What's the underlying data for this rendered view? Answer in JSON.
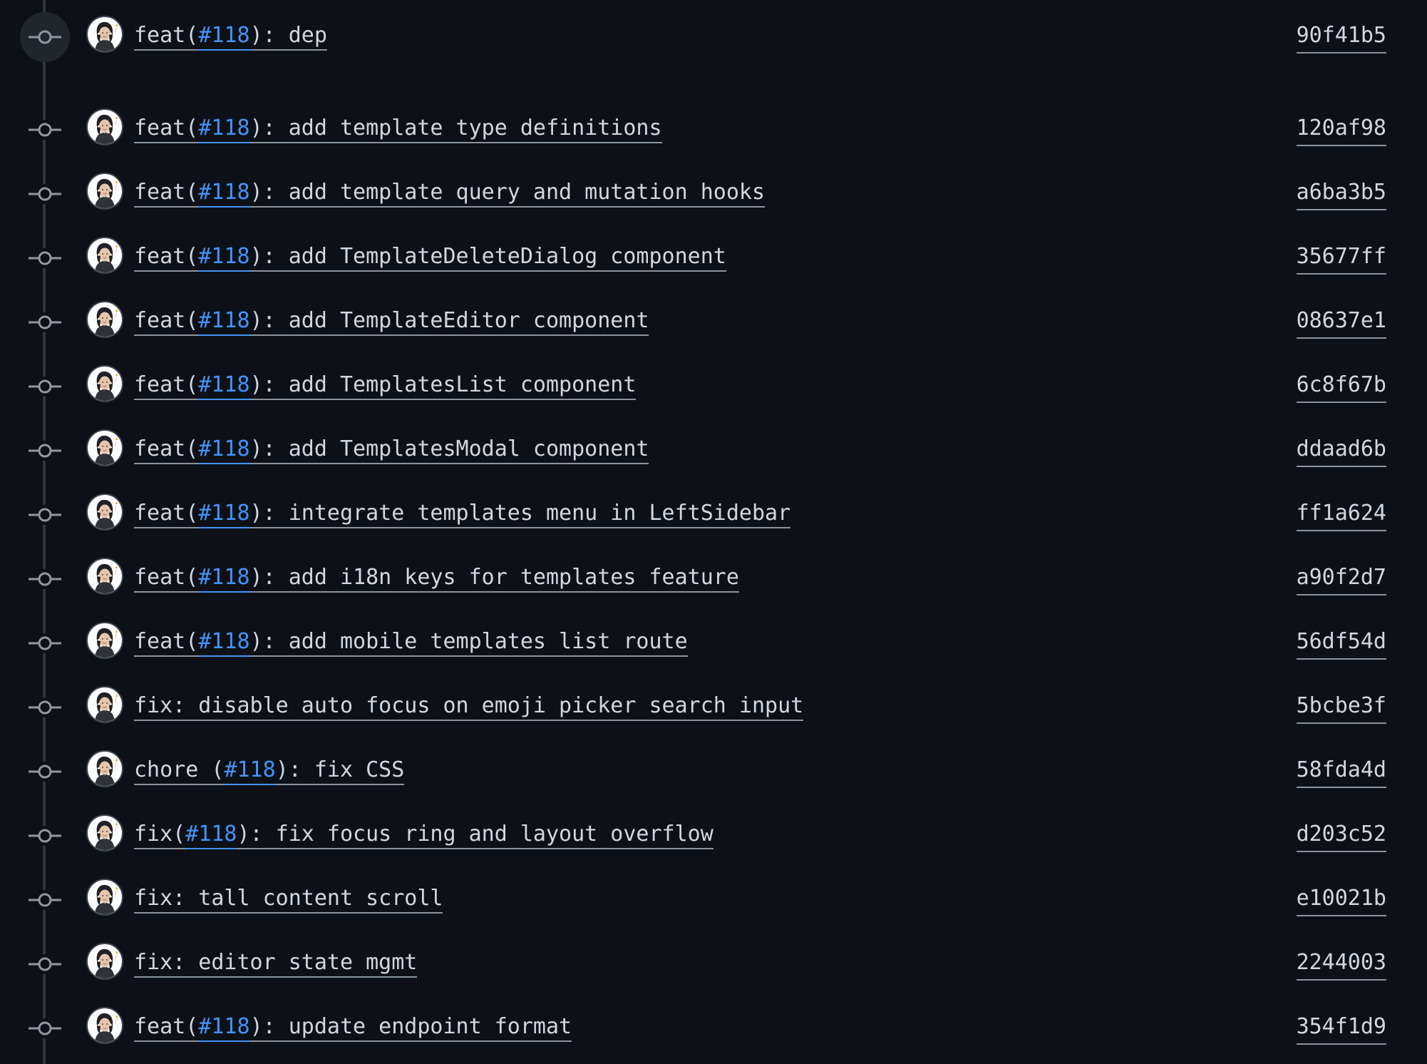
{
  "theme": {
    "background": "#0d1117",
    "text": "#d1d7e0",
    "link_issue": "#4493f8",
    "timeline": "#30363d",
    "hover_bg": "#21262d"
  },
  "icons": {
    "commit_node": "git-commit-icon",
    "author_avatar": "user-avatar"
  },
  "commits": [
    {
      "parts": [
        {
          "text": "feat("
        },
        {
          "text": "#118",
          "issue": true
        },
        {
          "text": "): dep"
        }
      ],
      "sha": "90f41b5",
      "hovered": true
    },
    {
      "parts": [
        {
          "text": "feat("
        },
        {
          "text": "#118",
          "issue": true
        },
        {
          "text": "): add template type definitions"
        }
      ],
      "sha": "120af98"
    },
    {
      "parts": [
        {
          "text": "feat("
        },
        {
          "text": "#118",
          "issue": true
        },
        {
          "text": "): add template query and mutation hooks"
        }
      ],
      "sha": "a6ba3b5"
    },
    {
      "parts": [
        {
          "text": "feat("
        },
        {
          "text": "#118",
          "issue": true
        },
        {
          "text": "): add TemplateDeleteDialog component"
        }
      ],
      "sha": "35677ff"
    },
    {
      "parts": [
        {
          "text": "feat("
        },
        {
          "text": "#118",
          "issue": true
        },
        {
          "text": "): add TemplateEditor component"
        }
      ],
      "sha": "08637e1"
    },
    {
      "parts": [
        {
          "text": "feat("
        },
        {
          "text": "#118",
          "issue": true
        },
        {
          "text": "): add TemplatesList component"
        }
      ],
      "sha": "6c8f67b"
    },
    {
      "parts": [
        {
          "text": "feat("
        },
        {
          "text": "#118",
          "issue": true
        },
        {
          "text": "): add TemplatesModal component"
        }
      ],
      "sha": "ddaad6b"
    },
    {
      "parts": [
        {
          "text": "feat("
        },
        {
          "text": "#118",
          "issue": true
        },
        {
          "text": "): integrate templates menu in LeftSidebar"
        }
      ],
      "sha": "ff1a624"
    },
    {
      "parts": [
        {
          "text": "feat("
        },
        {
          "text": "#118",
          "issue": true
        },
        {
          "text": "): add i18n keys for templates feature"
        }
      ],
      "sha": "a90f2d7"
    },
    {
      "parts": [
        {
          "text": "feat("
        },
        {
          "text": "#118",
          "issue": true
        },
        {
          "text": "): add mobile templates list route"
        }
      ],
      "sha": "56df54d"
    },
    {
      "parts": [
        {
          "text": "fix: disable auto focus on emoji picker search input"
        }
      ],
      "sha": "5bcbe3f"
    },
    {
      "parts": [
        {
          "text": "chore ("
        },
        {
          "text": "#118",
          "issue": true
        },
        {
          "text": "): fix CSS"
        }
      ],
      "sha": "58fda4d"
    },
    {
      "parts": [
        {
          "text": "fix("
        },
        {
          "text": "#118",
          "issue": true
        },
        {
          "text": "): fix focus ring and layout overflow"
        }
      ],
      "sha": "d203c52"
    },
    {
      "parts": [
        {
          "text": "fix: tall content scroll"
        }
      ],
      "sha": "e10021b"
    },
    {
      "parts": [
        {
          "text": "fix: editor state mgmt"
        }
      ],
      "sha": "2244003"
    },
    {
      "parts": [
        {
          "text": "feat("
        },
        {
          "text": "#118",
          "issue": true
        },
        {
          "text": "): update endpoint format"
        }
      ],
      "sha": "354f1d9"
    }
  ]
}
